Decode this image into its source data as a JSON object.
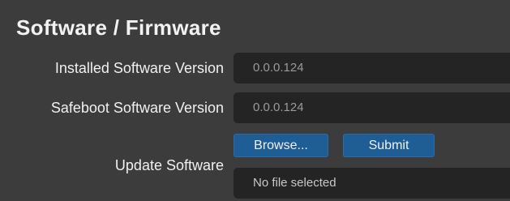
{
  "section": {
    "title": "Software / Firmware"
  },
  "rows": {
    "installed": {
      "label": "Installed Software Version",
      "value": "0.0.0.124"
    },
    "safeboot": {
      "label": "Safeboot Software Version",
      "value": "0.0.0.124"
    },
    "update": {
      "label": "Update Software",
      "browse_label": "Browse...",
      "submit_label": "Submit",
      "file_status": "No file selected"
    }
  },
  "colors": {
    "background": "#3c3c3c",
    "field_background": "#242424",
    "button_accent": "#1e5e95"
  }
}
